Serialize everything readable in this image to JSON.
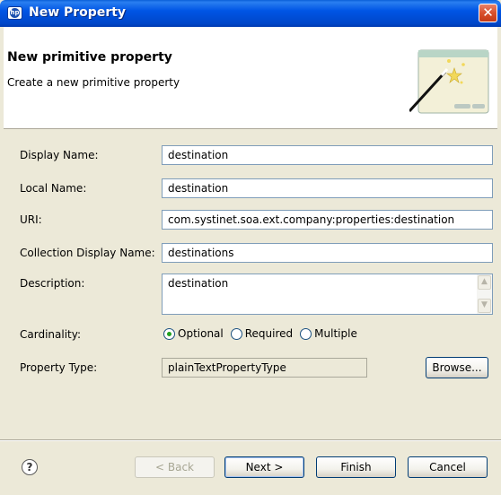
{
  "window": {
    "title": "New Property",
    "close_glyph": "✕"
  },
  "banner": {
    "title": "New primitive property",
    "subtitle": "Create a new primitive property"
  },
  "form": {
    "display_name": {
      "label": "Display Name:",
      "value": "destination"
    },
    "local_name": {
      "label": "Local Name:",
      "value": "destination"
    },
    "uri": {
      "label": "URI:",
      "value": "com.systinet.soa.ext.company:properties:destination"
    },
    "collection_display_name": {
      "label": "Collection Display Name:",
      "value": "destinations"
    },
    "description": {
      "label": "Description:",
      "value": "destination"
    },
    "cardinality": {
      "label": "Cardinality:",
      "options": [
        "Optional",
        "Required",
        "Multiple"
      ],
      "selected": "Optional"
    },
    "property_type": {
      "label": "Property Type:",
      "value": "plainTextPropertyType",
      "browse_label": "Browse..."
    }
  },
  "footer": {
    "help_glyph": "?",
    "back_label": "< Back",
    "next_label": "Next >",
    "finish_label": "Finish",
    "cancel_label": "Cancel"
  },
  "colors": {
    "titlebar": "#0055e5",
    "dialog_bg": "#ece9d8",
    "radio_selected": "#21a121"
  }
}
